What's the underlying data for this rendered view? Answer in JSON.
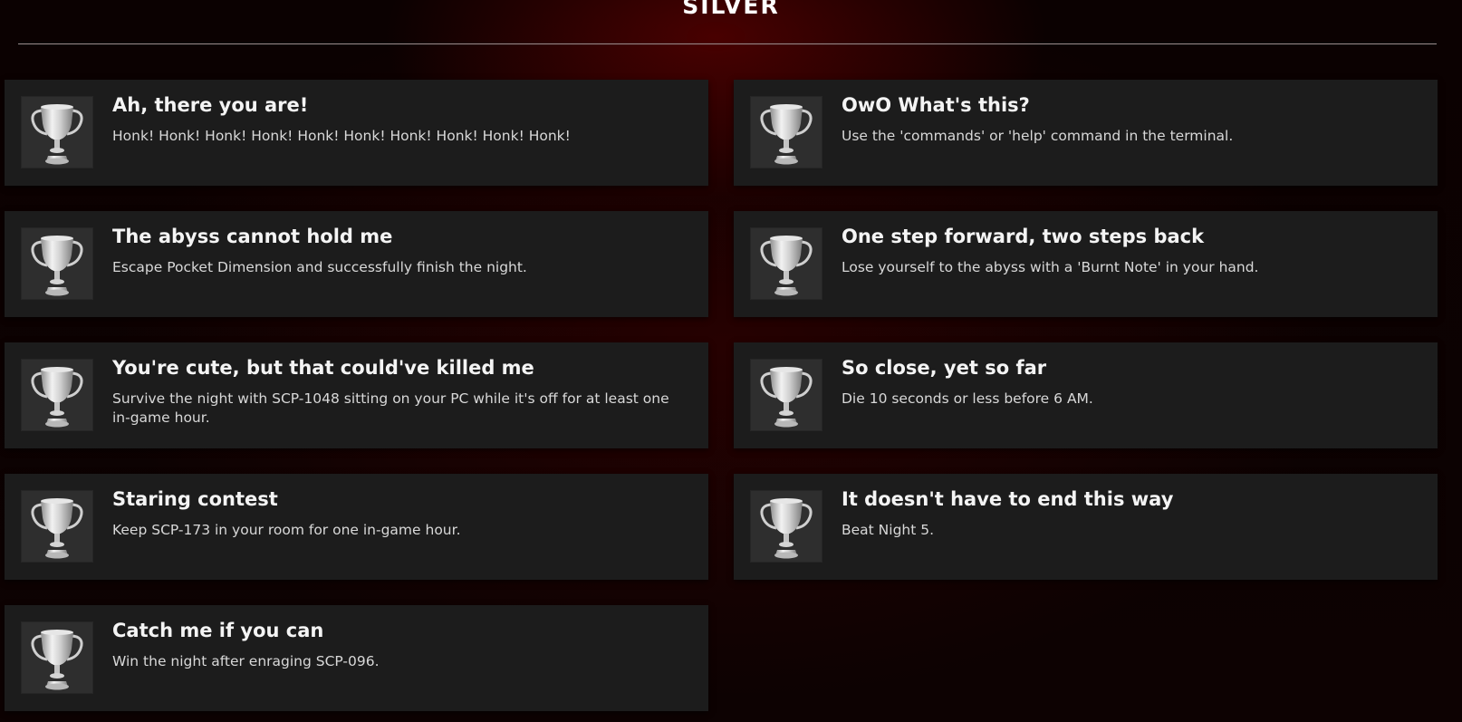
{
  "section": {
    "title": "SILVER"
  },
  "colors": {
    "card_background": "#1c1c1c",
    "accent_red": "#5a0000",
    "trophy_silver": "#d9d9d9"
  },
  "achievements": [
    {
      "icon": "silver-trophy-icon",
      "title": "Ah, there you are!",
      "description": "Honk! Honk! Honk! Honk! Honk! Honk! Honk! Honk! Honk! Honk!"
    },
    {
      "icon": "silver-trophy-icon",
      "title": "OwO What's this?",
      "description": "Use the 'commands' or 'help' command in the terminal."
    },
    {
      "icon": "silver-trophy-icon",
      "title": "The abyss cannot hold me",
      "description": "Escape Pocket Dimension and successfully finish the night."
    },
    {
      "icon": "silver-trophy-icon",
      "title": "One step forward, two steps back",
      "description": "Lose yourself to the abyss with a 'Burnt Note' in your hand."
    },
    {
      "icon": "silver-trophy-icon",
      "title": "You're cute, but that could've killed me",
      "description": "Survive the night with SCP-1048 sitting on your PC while it's off for at least one in-game hour."
    },
    {
      "icon": "silver-trophy-icon",
      "title": "So close, yet so far",
      "description": "Die 10 seconds or less before 6 AM."
    },
    {
      "icon": "silver-trophy-icon",
      "title": "Staring contest",
      "description": "Keep SCP-173 in your room for one in-game hour."
    },
    {
      "icon": "silver-trophy-icon",
      "title": "It doesn't have to end this way",
      "description": "Beat Night 5."
    },
    {
      "icon": "silver-trophy-icon",
      "title": "Catch me if you can",
      "description": "Win the night after enraging SCP-096."
    }
  ]
}
